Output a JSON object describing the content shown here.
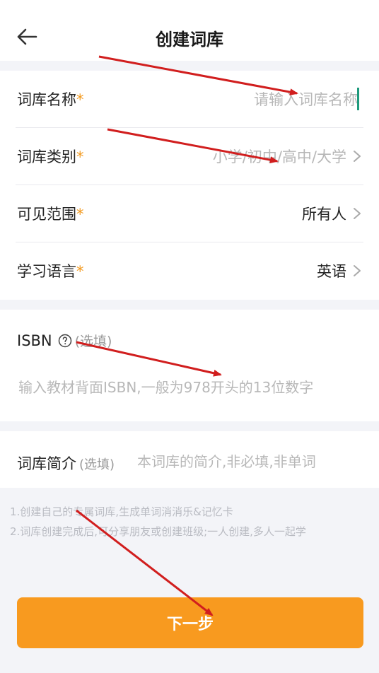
{
  "header": {
    "title": "创建词库",
    "back_icon": "arrow-left-icon"
  },
  "form": {
    "name": {
      "label": "词库名称",
      "required_mark": "*",
      "placeholder": "请输入词库名称"
    },
    "category": {
      "label": "词库类别",
      "required_mark": "*",
      "placeholder": "小学/初中/高中/大学",
      "icon": "chevron-right-icon"
    },
    "visibility": {
      "label": "可见范围",
      "required_mark": "*",
      "value": "所有人",
      "icon": "chevron-right-icon"
    },
    "language": {
      "label": "学习语言",
      "required_mark": "*",
      "value": "英语",
      "icon": "chevron-right-icon"
    },
    "isbn": {
      "label": "ISBN",
      "optional": "(选填)",
      "help_icon": "question-circle-icon",
      "placeholder": "输入教材背面ISBN,一般为978开头的13位数字"
    },
    "intro": {
      "label": "词库简介",
      "optional": "(选填)",
      "placeholder": "本词库的简介,非必填,非单词"
    }
  },
  "tips": [
    "1.创建自己的专属词库,生成单词消消乐&记忆卡",
    "2.词库创建完成后,可分享朋友或创建班级;一人创建,多人一起学"
  ],
  "next_button": {
    "label": "下一步"
  },
  "colors": {
    "accent": "#f89a1f",
    "required": "#f39a1f",
    "caret": "#1e9a7c",
    "annotation_arrow": "#d11e1e"
  }
}
